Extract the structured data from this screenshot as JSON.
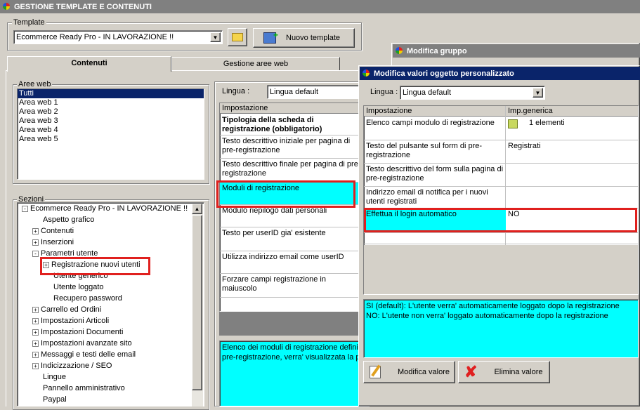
{
  "main_window": {
    "title": "GESTIONE TEMPLATE E CONTENUTI"
  },
  "template_group": {
    "label": "Template",
    "selected": "Ecommerce Ready Pro - IN LAVORAZIONE !!",
    "new_button": "Nuovo template"
  },
  "tabs": [
    "Contenuti",
    "Gestione aree web"
  ],
  "aree_web": {
    "label": "Aree web",
    "items": [
      "Tutti",
      "Area web 1",
      "Area web 2",
      "Area web 3",
      "Area web 4",
      "Area web 5"
    ]
  },
  "sezioni": {
    "label": "Sezioni",
    "items": [
      {
        "text": "Ecommerce Ready Pro - IN LAVORAZIONE !!",
        "level": 0,
        "pm": "-"
      },
      {
        "text": "Aspetto grafico",
        "level": 1,
        "pm": ""
      },
      {
        "text": "Contenuti",
        "level": 1,
        "pm": "+"
      },
      {
        "text": "Inserzioni",
        "level": 1,
        "pm": "+"
      },
      {
        "text": "Parametri utente",
        "level": 1,
        "pm": "-"
      },
      {
        "text": "Registrazione nuovi utenti",
        "level": 2,
        "pm": "+"
      },
      {
        "text": "Utente generico",
        "level": 2,
        "pm": ""
      },
      {
        "text": "Utente loggato",
        "level": 2,
        "pm": ""
      },
      {
        "text": "Recupero password",
        "level": 2,
        "pm": ""
      },
      {
        "text": "Carrello ed Ordini",
        "level": 1,
        "pm": "+"
      },
      {
        "text": "Impostazioni Articoli",
        "level": 1,
        "pm": "+"
      },
      {
        "text": "Impostazioni Documenti",
        "level": 1,
        "pm": "+"
      },
      {
        "text": "Impostazioni avanzate sito",
        "level": 1,
        "pm": "+"
      },
      {
        "text": "Messaggi e testi delle email",
        "level": 1,
        "pm": "+"
      },
      {
        "text": "Indicizzazione / SEO",
        "level": 1,
        "pm": "+"
      },
      {
        "text": "Lingue",
        "level": 1,
        "pm": ""
      },
      {
        "text": "Pannello amministrativo",
        "level": 1,
        "pm": ""
      },
      {
        "text": "Paypal",
        "level": 1,
        "pm": ""
      }
    ]
  },
  "middle": {
    "lingua_label": "Lingua :",
    "lingua_value": "Lingua default",
    "header": "Impostazione",
    "rows": [
      "Tipologia della scheda di registrazione (obbligatorio)",
      "Testo descrittivo iniziale per pagina di pre-registrazione",
      "Testo descrittivo finale per pagina di pre-registrazione",
      "Moduli di registrazione",
      "Modulo riepilogo dati personali",
      "Testo per userID gia' esistente",
      "Utilizza indirizzo email come userID",
      "Forzare campi registrazione in maiuscolo"
    ],
    "description": "Elenco dei moduli di registrazione definiti pre-registrazione, verra' visualizzata la p"
  },
  "modifica_gruppo": {
    "title": "Modifica gruppo"
  },
  "dialog": {
    "title": "Modifica valori oggetto personalizzato",
    "lingua_label": "Lingua :",
    "lingua_value": "Lingua default",
    "col1": "Impostazione",
    "col2": "Imp.generica",
    "rows": [
      {
        "name": "Elenco campi modulo di registrazione",
        "value": "1 elementi"
      },
      {
        "name": "Testo del pulsante sul form di pre-registrazione",
        "value": "Registrati"
      },
      {
        "name": "Testo descrittivo del form sulla pagina di pre-registrazione",
        "value": ""
      },
      {
        "name": "Indirizzo email di notifica per i nuovi utenti registrati",
        "value": ""
      },
      {
        "name": "Effettua il login automatico",
        "value": "NO"
      }
    ],
    "info_line1": "SI (default): L'utente verra' automaticamente loggato dopo la registrazione",
    "info_line2": "NO: L'utente non verra' loggato automaticamente dopo la registrazione",
    "btn_modify": "Modifica valore",
    "btn_delete": "Elimina valore"
  },
  "colors": {
    "selection": "#0a246a",
    "highlight": "#00ffff",
    "callout": "#e0201e",
    "face": "#d4d0c8"
  }
}
